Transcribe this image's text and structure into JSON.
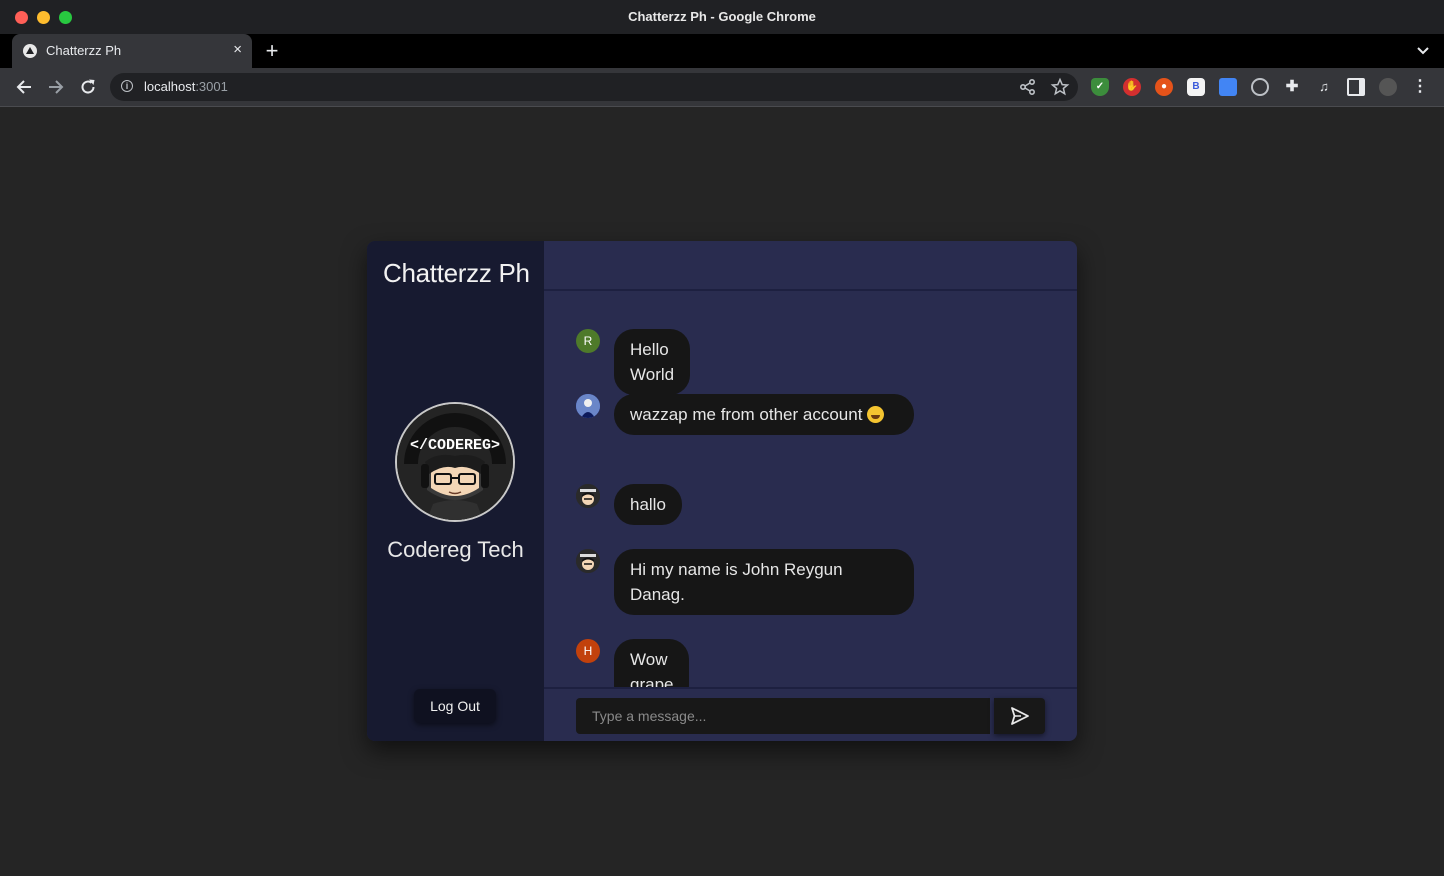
{
  "window": {
    "title": "Chatterzz Ph - Google Chrome"
  },
  "browser": {
    "tab_title": "Chatterzz Ph",
    "tab_close": "×",
    "new_tab": "+",
    "url_host": "localhost",
    "url_port": ":3001",
    "extension_letter": "B"
  },
  "app": {
    "brand": "Chatterzz Ph",
    "user_name": "Codereg Tech",
    "logout_label": "Log Out",
    "input_placeholder": "Type a message...",
    "messages": [
      {
        "avatar_letter": "R",
        "avatar_color": "#4e7a2a",
        "text": "Hello World"
      },
      {
        "avatar_letter": "",
        "avatar_icon": "user-photo-icon",
        "text": "wazzap me from other account",
        "emoji": "laughing-emoji"
      },
      {
        "avatar_letter": "",
        "avatar_icon": "codereg-avatar-icon",
        "text": "hallo"
      },
      {
        "avatar_letter": "",
        "avatar_icon": "codereg-avatar-icon",
        "text": "Hi my name is John Reygun Danag."
      },
      {
        "avatar_letter": "H",
        "avatar_color": "#c2410c",
        "text": "Wow grape"
      }
    ]
  },
  "colors": {
    "sidebar_bg": "#171a30",
    "chat_bg": "#292c4f",
    "bubble_bg": "#161616"
  }
}
